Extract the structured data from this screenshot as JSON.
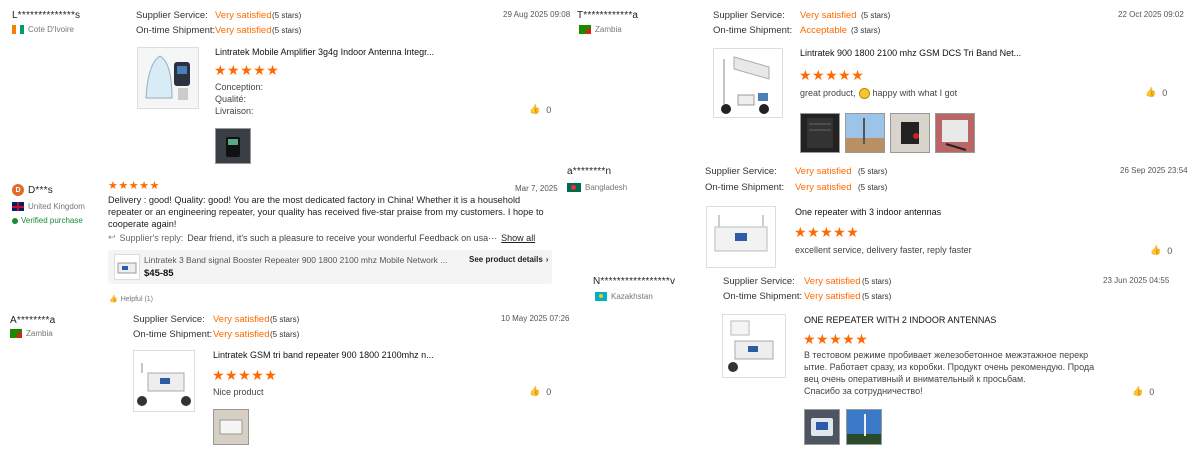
{
  "colors": {
    "accent": "#ff6a00",
    "zambia": "#198a00",
    "bangladesh": "#006a4e",
    "kazakhstan": "#00afca",
    "ivory_orange": "#f77f00",
    "ivory_green": "#009e60",
    "uk_blue": "#012169",
    "uk_red": "#c8102e"
  },
  "labels": {
    "supplier_service": "Supplier Service:",
    "ontime_shipment": "On-time Shipment:"
  },
  "reviews": [
    {
      "name": "L**************s",
      "country": "Cote D'Ivoire",
      "supplier": "Very satisfied",
      "supplier_stars": "(5 stars)",
      "shipment": "Very satisfied",
      "shipment_stars": "(5 stars)",
      "date": "29 Aug 2025 09:08",
      "product": "Lintratek Mobile Amplifier 3g4g Indoor Antenna Integr...",
      "lines": [
        "Conception:",
        "Qualité:",
        "Livraison:"
      ],
      "likes": "0"
    },
    {
      "name": "T************a",
      "country": "Zambia",
      "supplier": "Very satisfied",
      "supplier_stars": "(5 stars)",
      "shipment": "Acceptable",
      "shipment_stars": "(3 stars)",
      "date": "22 Oct 2025 09:02",
      "product": "Lintratek 900 1800 2100 mhz GSM DCS Tri Band Net...",
      "text_before": "great product,",
      "text_after": "happy with what I got",
      "likes": "0"
    },
    {
      "name": "D***s",
      "avatar": "D",
      "country": "United Kingdom",
      "verified": "Verified purchase",
      "date": "Mar 7, 2025",
      "text": "Delivery : good!   Quality: good!   You are the most dedicated factory in China!  Whether it is a household repeater or an engineering repeater, your quality has received five-star praise from my customers. I hope to cooperate again!",
      "reply_label": "Supplier's reply:",
      "reply_text": "Dear friend, it's such a pleasure to receive your wonderful Feedback on usa···",
      "show_all": "Show all",
      "card_title": "Lintratek 3 Band signal Booster Repeater 900 1800 2100 mhz Mobile Network ...",
      "card_price": "$45-85",
      "card_link": "See product details",
      "helpful": "Helpful (1)"
    },
    {
      "name": "a********n",
      "country": "Bangladesh",
      "supplier": "Very satisfied",
      "supplier_stars": "(5 stars)",
      "shipment": "Very satisfied",
      "shipment_stars": "(5 stars)",
      "date": "26 Sep 2025 23:54",
      "product": "One repeater with 3 indoor antennas",
      "text": "excellent service, delivery faster, reply faster",
      "likes": "0"
    },
    {
      "name": "A********a",
      "country": "Zambia",
      "supplier": "Very satisfied",
      "supplier_stars": "(5 stars)",
      "shipment": "Very satisfied",
      "shipment_stars": "(5 stars)",
      "date": "10 May 2025 07:26",
      "product": "Lintratek GSM tri band repeater 900 1800 2100mhz n...",
      "text": "Nice product",
      "likes": "0"
    },
    {
      "name": "N*****************v",
      "country": "Kazakhstan",
      "supplier": "Very satisfied",
      "supplier_stars": "(5 stars)",
      "shipment": "Very satisfied",
      "shipment_stars": "(5 stars)",
      "date": "23 Jun 2025 04:55",
      "product": "ONE REPEATER WITH 2 INDOOR ANTENNAS",
      "text_lines": [
        "В тестовом режиме пробивает железобетонное межэтажное перекр",
        "ытие. Работает сразу, из коробки. Продукт очень рекомендую. Прода",
        "вец очень оперативный и внимательный к просьбам.",
        "Спасибо за сотрудничество!"
      ],
      "likes": "0"
    }
  ]
}
